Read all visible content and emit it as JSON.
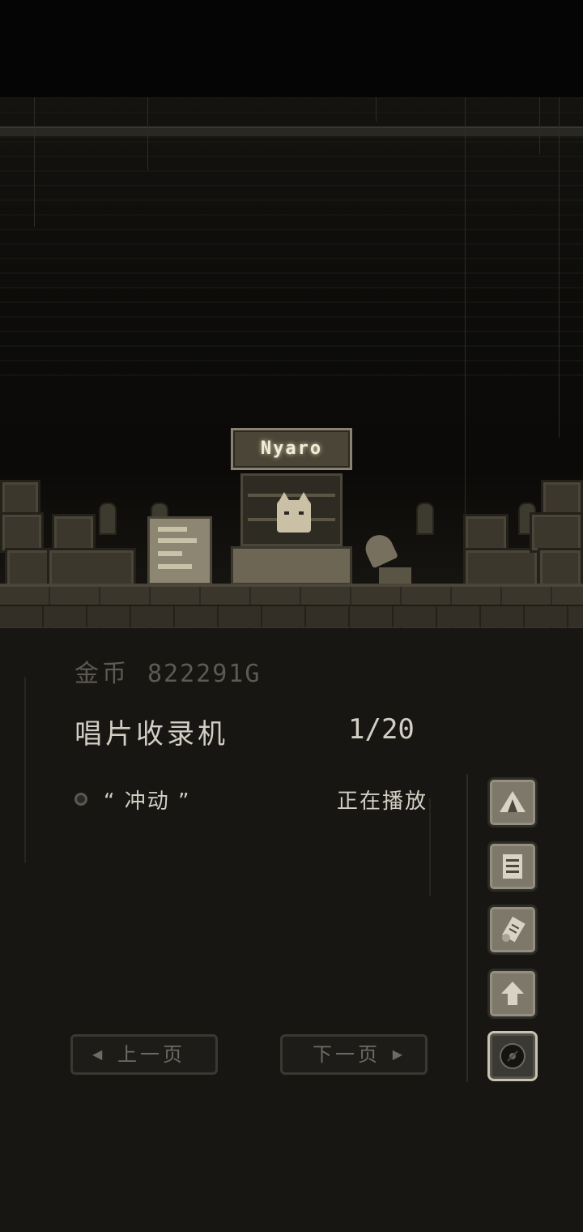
{
  "scene": {
    "shop_sign": "Nyaro"
  },
  "status": {
    "gold_label": "金币",
    "gold_value": "822291G"
  },
  "header": {
    "title": "唱片收录机",
    "page": "1/20"
  },
  "records": [
    {
      "title": "“ 冲动 ”",
      "status": "正在播放"
    }
  ],
  "side_menu": [
    {
      "icon": "tent-icon"
    },
    {
      "icon": "notebook-icon"
    },
    {
      "icon": "scroll-icon"
    },
    {
      "icon": "upgrade-arrow-icon"
    },
    {
      "icon": "record-disc-icon",
      "active": true
    }
  ],
  "nav": {
    "prev_label": "上一页",
    "next_label": "下一页"
  },
  "colors": {
    "text_primary": "#d2cec3",
    "text_dim": "#5c5a52",
    "button_face": "#7d786a",
    "panel_bg": "#171612"
  }
}
